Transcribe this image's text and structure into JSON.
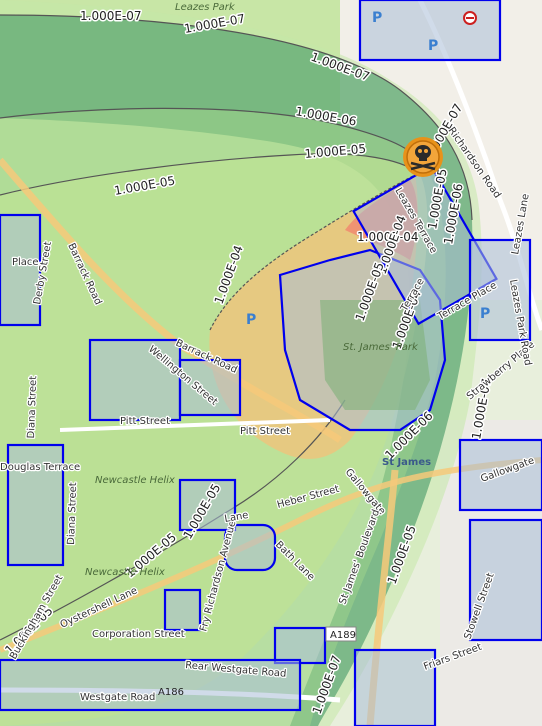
{
  "contour_labels": [
    {
      "id": "c1",
      "text": "1.000E-07"
    },
    {
      "id": "c2",
      "text": "1.000E-07"
    },
    {
      "id": "c3",
      "text": "1.000E-07"
    },
    {
      "id": "c4",
      "text": "1.000E-06"
    },
    {
      "id": "c5",
      "text": "1.000E-05"
    },
    {
      "id": "c6",
      "text": "1.000E-05"
    },
    {
      "id": "c7",
      "text": "1.000E-04"
    },
    {
      "id": "c8",
      "text": "1.000E-07"
    },
    {
      "id": "c9",
      "text": "1.000E-06"
    },
    {
      "id": "c10",
      "text": "1.000E-05"
    },
    {
      "id": "c11",
      "text": "1.000E-04"
    },
    {
      "id": "c12",
      "text": "1.000E-04"
    },
    {
      "id": "c13",
      "text": "1.000E-05"
    },
    {
      "id": "c14",
      "text": "1.000E-04"
    },
    {
      "id": "c15",
      "text": "1.000E-05"
    },
    {
      "id": "c16",
      "text": "1.000E-05"
    },
    {
      "id": "c17",
      "text": "1.000E-05"
    },
    {
      "id": "c18",
      "text": "1.000E-06"
    },
    {
      "id": "c19",
      "text": "1.000E-07"
    },
    {
      "id": "c20",
      "text": "1.000E-05"
    },
    {
      "id": "c21",
      "text": "1.000E-07"
    }
  ],
  "streets": {
    "richardson_road": "Richardson Road",
    "barrack_road": "Barrack Road",
    "barrack_road_2": "Barrack Road",
    "wellington_street": "Wellington Street",
    "pitt_street": "Pitt Street",
    "pitt_street_2": "Pitt Street",
    "diana_street": "Diana Street",
    "diana_street_2": "Diana Street",
    "douglas_terrace": "Douglas Terrace",
    "derby_street": "Derby Street",
    "place": "Place",
    "gallowgate": "Gallowgate",
    "gallowgate_2": "Gallowgate",
    "heber_street": "Heber Street",
    "bath_lane": "Bath Lane",
    "st_james_boulevard": "St James' Boulevard",
    "corporation_street": "Corporation Street",
    "westgate_road": "Westgate Road",
    "rear_westgate_road": "Rear Westgate Road",
    "fry_richardson_avenue": "Fry Richardson Avenue",
    "oysterhell_lane": "Oystershell Lane",
    "buckingham_street": "Buckingham Street",
    "strawberry_place": "Strawberry Place",
    "leazes_park_road": "Leazes Park Road",
    "leazes_lane": "Leazes Lane",
    "terrace_place": "Terrace Place",
    "stowell_street": "Stowell Street",
    "friars_street": "Friars Street",
    "leazes_terrace": "Leazes Terrace",
    "wellington_lane": "Lane",
    "bowl_terrace": "Terrace"
  },
  "areas": {
    "leazes_park": "Leazes Park",
    "newcastle_helix": "Newcastle Helix",
    "newcastle_helix_2": "Newcastle Helix",
    "st_james_park": "St. James' Park",
    "st_james_station": "St James"
  },
  "road_refs": {
    "a189": "A189",
    "a186": "A186"
  },
  "parking_symbol": "P",
  "colors": {
    "contour_1e7": "#4f9e6b",
    "contour_1e6": "#6fbf7a",
    "contour_1e5": "#b8e08a",
    "contour_1e4": "#f4c07a",
    "contour_1e3": "#f08a70",
    "building_outline": "#0000ee",
    "source_marker": "#e8921a",
    "road_primary": "#f6c97a"
  },
  "icons": {
    "source": "hazard-skull-icon",
    "parking": "parking-icon"
  }
}
